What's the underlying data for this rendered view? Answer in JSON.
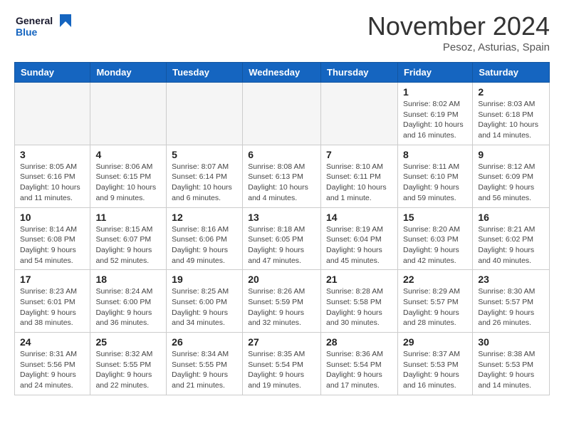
{
  "header": {
    "logo_line1": "General",
    "logo_line2": "Blue",
    "month_title": "November 2024",
    "location": "Pesoz, Asturias, Spain"
  },
  "weekdays": [
    "Sunday",
    "Monday",
    "Tuesday",
    "Wednesday",
    "Thursday",
    "Friday",
    "Saturday"
  ],
  "weeks": [
    [
      {
        "day": "",
        "info": ""
      },
      {
        "day": "",
        "info": ""
      },
      {
        "day": "",
        "info": ""
      },
      {
        "day": "",
        "info": ""
      },
      {
        "day": "",
        "info": ""
      },
      {
        "day": "1",
        "info": "Sunrise: 8:02 AM\nSunset: 6:19 PM\nDaylight: 10 hours\nand 16 minutes."
      },
      {
        "day": "2",
        "info": "Sunrise: 8:03 AM\nSunset: 6:18 PM\nDaylight: 10 hours\nand 14 minutes."
      }
    ],
    [
      {
        "day": "3",
        "info": "Sunrise: 8:05 AM\nSunset: 6:16 PM\nDaylight: 10 hours\nand 11 minutes."
      },
      {
        "day": "4",
        "info": "Sunrise: 8:06 AM\nSunset: 6:15 PM\nDaylight: 10 hours\nand 9 minutes."
      },
      {
        "day": "5",
        "info": "Sunrise: 8:07 AM\nSunset: 6:14 PM\nDaylight: 10 hours\nand 6 minutes."
      },
      {
        "day": "6",
        "info": "Sunrise: 8:08 AM\nSunset: 6:13 PM\nDaylight: 10 hours\nand 4 minutes."
      },
      {
        "day": "7",
        "info": "Sunrise: 8:10 AM\nSunset: 6:11 PM\nDaylight: 10 hours\nand 1 minute."
      },
      {
        "day": "8",
        "info": "Sunrise: 8:11 AM\nSunset: 6:10 PM\nDaylight: 9 hours\nand 59 minutes."
      },
      {
        "day": "9",
        "info": "Sunrise: 8:12 AM\nSunset: 6:09 PM\nDaylight: 9 hours\nand 56 minutes."
      }
    ],
    [
      {
        "day": "10",
        "info": "Sunrise: 8:14 AM\nSunset: 6:08 PM\nDaylight: 9 hours\nand 54 minutes."
      },
      {
        "day": "11",
        "info": "Sunrise: 8:15 AM\nSunset: 6:07 PM\nDaylight: 9 hours\nand 52 minutes."
      },
      {
        "day": "12",
        "info": "Sunrise: 8:16 AM\nSunset: 6:06 PM\nDaylight: 9 hours\nand 49 minutes."
      },
      {
        "day": "13",
        "info": "Sunrise: 8:18 AM\nSunset: 6:05 PM\nDaylight: 9 hours\nand 47 minutes."
      },
      {
        "day": "14",
        "info": "Sunrise: 8:19 AM\nSunset: 6:04 PM\nDaylight: 9 hours\nand 45 minutes."
      },
      {
        "day": "15",
        "info": "Sunrise: 8:20 AM\nSunset: 6:03 PM\nDaylight: 9 hours\nand 42 minutes."
      },
      {
        "day": "16",
        "info": "Sunrise: 8:21 AM\nSunset: 6:02 PM\nDaylight: 9 hours\nand 40 minutes."
      }
    ],
    [
      {
        "day": "17",
        "info": "Sunrise: 8:23 AM\nSunset: 6:01 PM\nDaylight: 9 hours\nand 38 minutes."
      },
      {
        "day": "18",
        "info": "Sunrise: 8:24 AM\nSunset: 6:00 PM\nDaylight: 9 hours\nand 36 minutes."
      },
      {
        "day": "19",
        "info": "Sunrise: 8:25 AM\nSunset: 6:00 PM\nDaylight: 9 hours\nand 34 minutes."
      },
      {
        "day": "20",
        "info": "Sunrise: 8:26 AM\nSunset: 5:59 PM\nDaylight: 9 hours\nand 32 minutes."
      },
      {
        "day": "21",
        "info": "Sunrise: 8:28 AM\nSunset: 5:58 PM\nDaylight: 9 hours\nand 30 minutes."
      },
      {
        "day": "22",
        "info": "Sunrise: 8:29 AM\nSunset: 5:57 PM\nDaylight: 9 hours\nand 28 minutes."
      },
      {
        "day": "23",
        "info": "Sunrise: 8:30 AM\nSunset: 5:57 PM\nDaylight: 9 hours\nand 26 minutes."
      }
    ],
    [
      {
        "day": "24",
        "info": "Sunrise: 8:31 AM\nSunset: 5:56 PM\nDaylight: 9 hours\nand 24 minutes."
      },
      {
        "day": "25",
        "info": "Sunrise: 8:32 AM\nSunset: 5:55 PM\nDaylight: 9 hours\nand 22 minutes."
      },
      {
        "day": "26",
        "info": "Sunrise: 8:34 AM\nSunset: 5:55 PM\nDaylight: 9 hours\nand 21 minutes."
      },
      {
        "day": "27",
        "info": "Sunrise: 8:35 AM\nSunset: 5:54 PM\nDaylight: 9 hours\nand 19 minutes."
      },
      {
        "day": "28",
        "info": "Sunrise: 8:36 AM\nSunset: 5:54 PM\nDaylight: 9 hours\nand 17 minutes."
      },
      {
        "day": "29",
        "info": "Sunrise: 8:37 AM\nSunset: 5:53 PM\nDaylight: 9 hours\nand 16 minutes."
      },
      {
        "day": "30",
        "info": "Sunrise: 8:38 AM\nSunset: 5:53 PM\nDaylight: 9 hours\nand 14 minutes."
      }
    ]
  ]
}
